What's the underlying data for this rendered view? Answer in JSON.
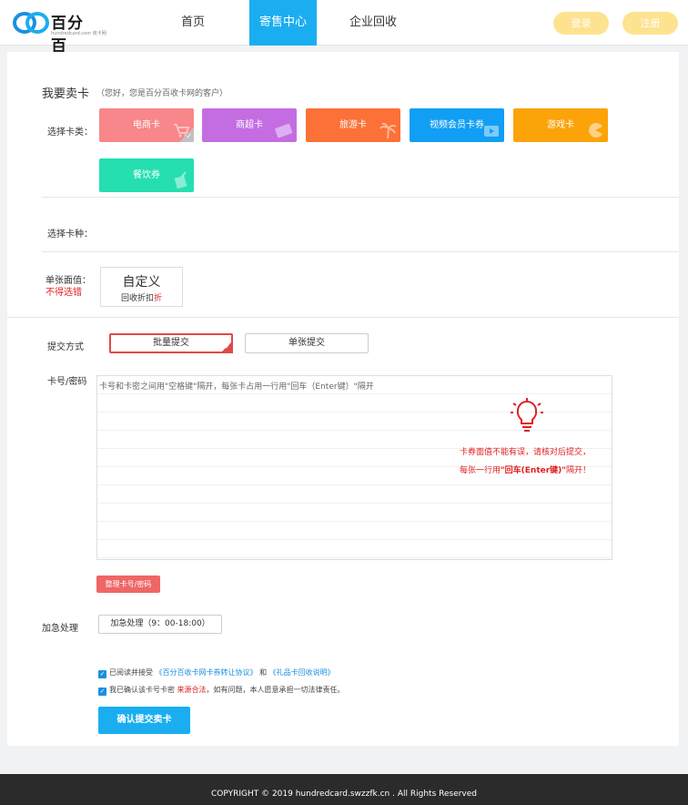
{
  "header": {
    "logo_text": "百分百",
    "logo_sub": "hundredcard.com 收卡网",
    "nav": [
      {
        "label": "首页"
      },
      {
        "label": "寄售中心"
      },
      {
        "label": "企业回收"
      }
    ],
    "login_label": "登录",
    "register_label": "注册"
  },
  "colors": {
    "accent": "#1aaef0",
    "header_button": "#fde38f",
    "alert_red": "#e02020"
  },
  "sell": {
    "title": "我要卖卡",
    "subtitle": "（您好，您是百分百收卡网的客户）",
    "category_label": "选择卡类：",
    "categories": [
      {
        "label": "电商卡",
        "color": "#f8868a",
        "icon": "cart-icon",
        "selected": true
      },
      {
        "label": "商超卡",
        "color": "#c46de3",
        "icon": "card-icon",
        "selected": false
      },
      {
        "label": "旅游卡",
        "color": "#fb7137",
        "icon": "palm-tree-icon",
        "selected": false
      },
      {
        "label": "视频会员卡券",
        "color": "#119ef5",
        "icon": "video-icon",
        "selected": false
      },
      {
        "label": "游戏卡",
        "color": "#fca30a",
        "icon": "pacman-icon",
        "selected": false
      },
      {
        "label": "餐饮券",
        "color": "#25dfb1",
        "icon": "drink-icon",
        "selected": false
      }
    ],
    "type_label": "选择卡种：",
    "value_label": "单张面值：",
    "value_note": "不得选错",
    "custom_main": "自定义",
    "custom_sub_prefix": "回收折扣",
    "custom_sub_suffix": "折",
    "mode_label": "提交方式",
    "mode_batch": "批量提交",
    "mode_single": "单张提交",
    "card_label": "卡号/密码",
    "textarea_placeholder": "卡号和卡密之间用\"空格键\"隔开，每张卡占用一行用\"回车（Enter键）\"隔开",
    "notice_line1": "卡券面值不能有误，请核对后提交，",
    "notice_line2_prefix": "每张一行用",
    "notice_line2_bold": "\"回车(Enter键)\"",
    "notice_line2_suffix": "隔开！",
    "sort_button": "整理卡号/密码",
    "urgent_label": "加急处理",
    "urgent_button": "加急处理（9：00-18:00）",
    "agree1_prefix": "已阅读并接受",
    "agree1_link1": "《百分百收卡网卡券转让协议》",
    "agree1_mid": "和",
    "agree1_link2": "《礼品卡回收说明》",
    "agree2_prefix": "我已确认该卡号卡密",
    "agree2_red": "来源合法",
    "agree2_suffix": "，如有问题，本人愿意承担一切法律责任。",
    "submit_button": "确认提交卖卡"
  },
  "footer": {
    "copyright": "COPYRIGHT © 2019 hundredcard.swzzfk.cn . All Rights Reserved"
  }
}
